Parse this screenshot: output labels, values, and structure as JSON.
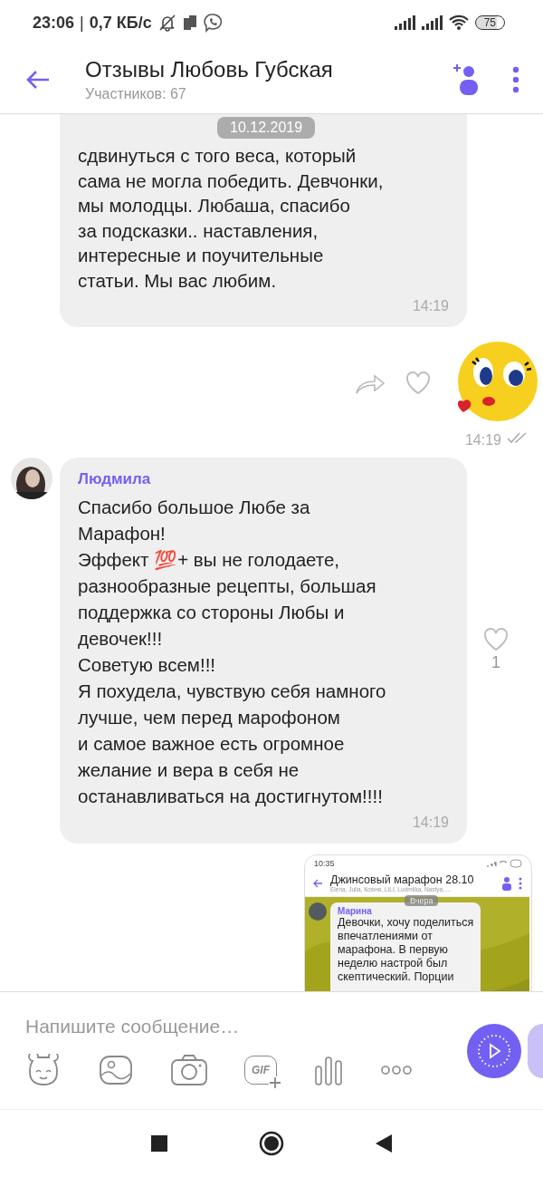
{
  "status_bar": {
    "time": "23:06",
    "separator": "|",
    "speed": "0,7 КБ/с",
    "battery": "75"
  },
  "header": {
    "title": "Отзывы Любовь Губская",
    "subtitle": "Участников: 67"
  },
  "date_chip": "10.12.2019",
  "messages": [
    {
      "kind": "text",
      "text": "сдвинуться с того веса, который\nсама не могла победить. Девчонки,\nмы молодцы. Любаша, спасибо\nза подсказки.. наставления,\nинтересные и поучительные\nстатьи. Мы вас любим.",
      "time": "14:19"
    },
    {
      "kind": "sticker",
      "time": "14:19"
    },
    {
      "kind": "text",
      "sender": "Людмила",
      "text": "Спасибо большое Любе за\nМарафон!\nЭффект 💯+ вы не голодаете,\nразнообразные рецепты, большая\nподдержка со стороны Любы и\nдевочек!!!\nСоветую всем!!!\nЯ похудела, чувствую себя намного\nлучше, чем перед марофоном\nи самое важное есть огромное\nжелание и вера в себя не\nостанавливаться на достигнутом!!!!",
      "time": "14:19",
      "likes": "1"
    },
    {
      "kind": "screenshot",
      "shot": {
        "time": "10:35",
        "title": "Джинсовый марафон 28.10",
        "subtitle": "Elena, Julia, Ксюня, LILI, Ludmilka, Nastya, ...",
        "date_chip": "Вчера",
        "sender": "Марина",
        "text": "Девочки, хочу поделиться\nвпечатлениями от\nмарафона. В первую\nнеделю настрой был\nскептический. Порции"
      }
    }
  ],
  "composer": {
    "placeholder": "Напишите сообщение…",
    "gif_label": "GIF"
  }
}
